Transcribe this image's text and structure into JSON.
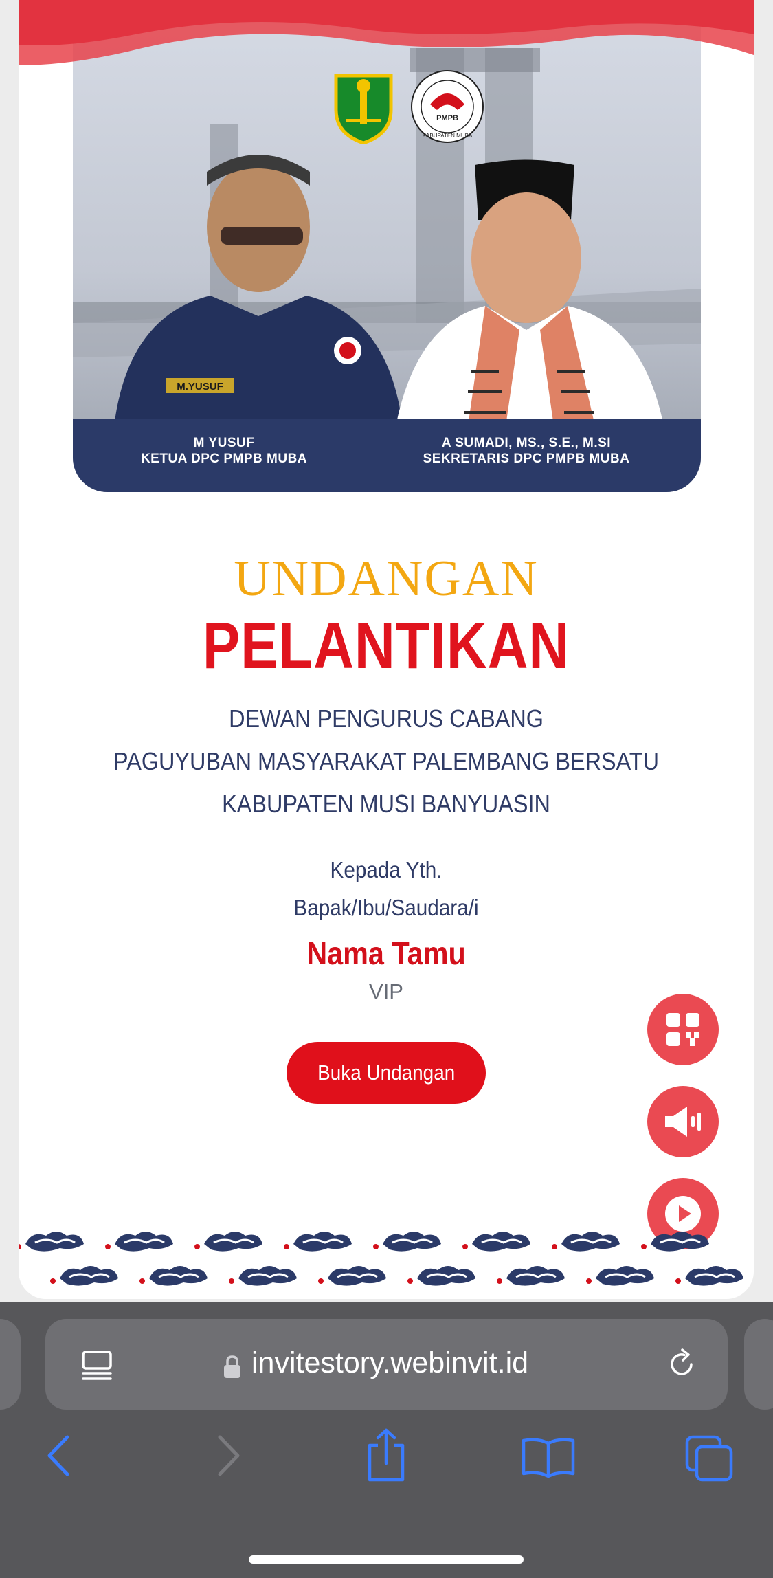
{
  "banner": {
    "left_name": "M YUSUF",
    "left_role": "KETUA DPC PMPB MUBA",
    "right_name": "A SUMADI, MS., S.E., M.SI",
    "right_role": "SEKRETARIS DPC PMPB MUBA",
    "left_badge": "M.YUSUF",
    "logo_text": "PMPB",
    "logo_caption": "KABUPATEN MUBA"
  },
  "invitation": {
    "title_top": "UNDANGAN",
    "title_main": "PELANTIKAN",
    "org_lines": [
      "DEWAN PENGURUS CABANG",
      "PAGUYUBAN MASYARAKAT PALEMBANG BERSATU",
      "KABUPATEN MUSI BANYUASIN"
    ],
    "to_lines": [
      "Kepada Yth.",
      "Bapak/Ibu/Saudara/i"
    ],
    "guest_name": "Nama Tamu",
    "guest_category": "VIP",
    "open_button": "Buka Undangan"
  },
  "fabs": [
    "qr-code-icon",
    "speaker-icon",
    "play-icon"
  ],
  "colors": {
    "accent_red": "#e0101b",
    "gold": "#f3a712",
    "navy": "#2f3b66",
    "fab": "#ea4a52"
  },
  "browser": {
    "url": "invitestory.webinvit.id"
  }
}
